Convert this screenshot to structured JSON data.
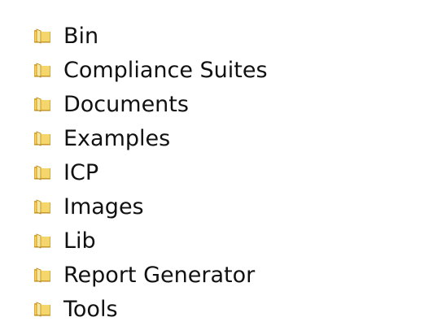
{
  "folder_list": {
    "items": [
      {
        "label": "Bin",
        "icon": "folder-icon"
      },
      {
        "label": "Compliance Suites",
        "icon": "folder-icon"
      },
      {
        "label": "Documents",
        "icon": "folder-icon"
      },
      {
        "label": "Examples",
        "icon": "folder-icon"
      },
      {
        "label": "ICP",
        "icon": "folder-icon"
      },
      {
        "label": "Images",
        "icon": "folder-icon"
      },
      {
        "label": "Lib",
        "icon": "folder-icon"
      },
      {
        "label": "Report Generator",
        "icon": "folder-icon"
      },
      {
        "label": "Tools",
        "icon": "folder-icon"
      }
    ]
  },
  "colors": {
    "background": "#ffffff",
    "text": "#111111",
    "folder_light": "#f7e391",
    "folder_mid": "#e2bb45",
    "folder_dark": "#b8891e"
  }
}
